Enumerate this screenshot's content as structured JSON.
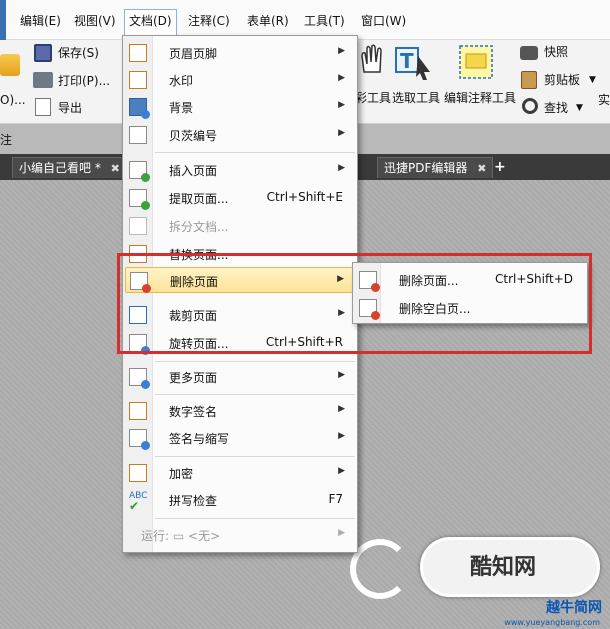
{
  "menubar": {
    "items": [
      {
        "label": "编辑(E)"
      },
      {
        "label": "视图(V)"
      },
      {
        "label": "文档(D)"
      },
      {
        "label": "注释(C)"
      },
      {
        "label": "表单(R)"
      },
      {
        "label": "工具(T)"
      },
      {
        "label": "窗口(W)"
      }
    ]
  },
  "ribbon": {
    "left_label": "O)...",
    "save": "保存(S)",
    "print": "打印(P)...",
    "export": "导出",
    "hand_tool": "彩工具",
    "select_tool": "选取工具",
    "edit_annot_tool": "编辑注释工具",
    "snapshot": "快照",
    "clipboard": "剪贴板",
    "find": "查找",
    "far_right": "实",
    "bottom_left": "注"
  },
  "tabs": [
    {
      "label": "小编自己看吧 *"
    },
    {
      "label": "迅捷PDF编辑器"
    }
  ],
  "tab_add": "+",
  "tab_close": "✖",
  "doc_menu": {
    "items": [
      {
        "label": "页眉页脚",
        "arrow": "▶"
      },
      {
        "label": "水印",
        "arrow": "▶"
      },
      {
        "label": "背景",
        "arrow": "▶"
      },
      {
        "label": "贝茨编号",
        "arrow": "▶"
      },
      {
        "label": "插入页面",
        "arrow": "▶"
      },
      {
        "label": "提取页面...",
        "shortcut": "Ctrl+Shift+E"
      },
      {
        "label": "拆分文档..."
      },
      {
        "label": "替换页面..."
      },
      {
        "label": "删除页面",
        "arrow": "▶"
      },
      {
        "label": "裁剪页面",
        "arrow": "▶"
      },
      {
        "label": "旋转页面...",
        "shortcut": "Ctrl+Shift+R"
      },
      {
        "label": "更多页面",
        "arrow": "▶"
      },
      {
        "label": "数字签名",
        "arrow": "▶"
      },
      {
        "label": "签名与缩写",
        "arrow": "▶"
      },
      {
        "label": "加密",
        "arrow": "▶"
      },
      {
        "label": "拼写检查",
        "shortcut": "F7"
      },
      {
        "label": "运行: ▭ <无>",
        "arrow": "▶"
      }
    ]
  },
  "sub_menu": {
    "items": [
      {
        "label": "删除页面...",
        "shortcut": "Ctrl+Shift+D"
      },
      {
        "label": "删除空白页..."
      }
    ]
  },
  "watermark": {
    "brand": "酷知网",
    "site_name": "越牛简网",
    "site_url": "www.yueyangbang.com"
  },
  "colors": {
    "accent_highlight": "#fde396",
    "annotation_red": "#d32f2f",
    "tab_bar": "#3a3a3a"
  }
}
